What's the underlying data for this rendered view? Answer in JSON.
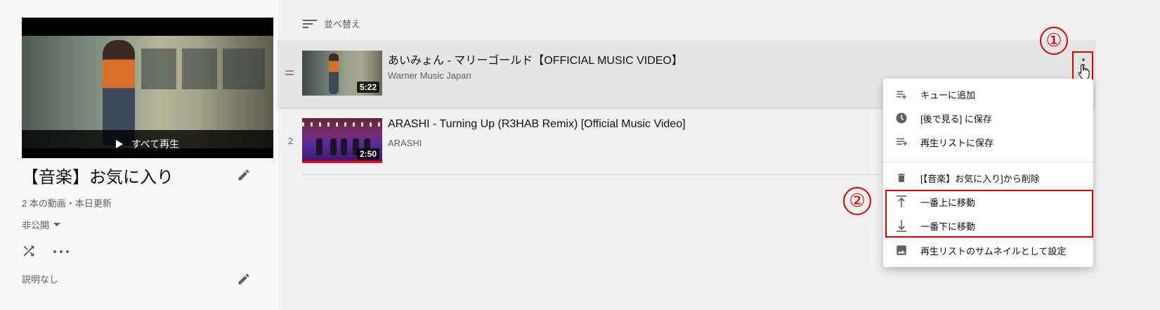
{
  "playlist": {
    "title": "【音楽】お気に入り",
    "play_all_label": "すべて再生",
    "meta": "2 本の動画・本日更新",
    "privacy": "非公開",
    "description": "説明なし"
  },
  "sort": {
    "label": "並べ替え"
  },
  "videos": [
    {
      "index": "",
      "title": "あいみょん - マリーゴールド【OFFICIAL MUSIC VIDEO】",
      "channel": "Warner Music Japan",
      "duration": "5:22"
    },
    {
      "index": "2",
      "title": "ARASHI - Turning Up (R3HAB Remix) [Official Music Video]",
      "channel": "ARASHI",
      "duration": "2:50"
    }
  ],
  "menu": {
    "items": [
      {
        "label": "キューに追加",
        "icon": "queue-icon"
      },
      {
        "label": "[後で見る] に保存",
        "icon": "clock-icon"
      },
      {
        "label": "再生リストに保存",
        "icon": "playlist-add-icon"
      },
      {
        "label": "[【音楽】お気に入り]から削除",
        "icon": "trash-icon"
      },
      {
        "label": "一番上に移動",
        "icon": "move-top-icon"
      },
      {
        "label": "一番下に移動",
        "icon": "move-bottom-icon"
      },
      {
        "label": "再生リストのサムネイルとして設定",
        "icon": "image-icon"
      }
    ]
  },
  "annotations": {
    "step1": "①",
    "step2": "②"
  },
  "colors": {
    "annotation_red": "#e00000",
    "progress_red": "#ff0000"
  }
}
